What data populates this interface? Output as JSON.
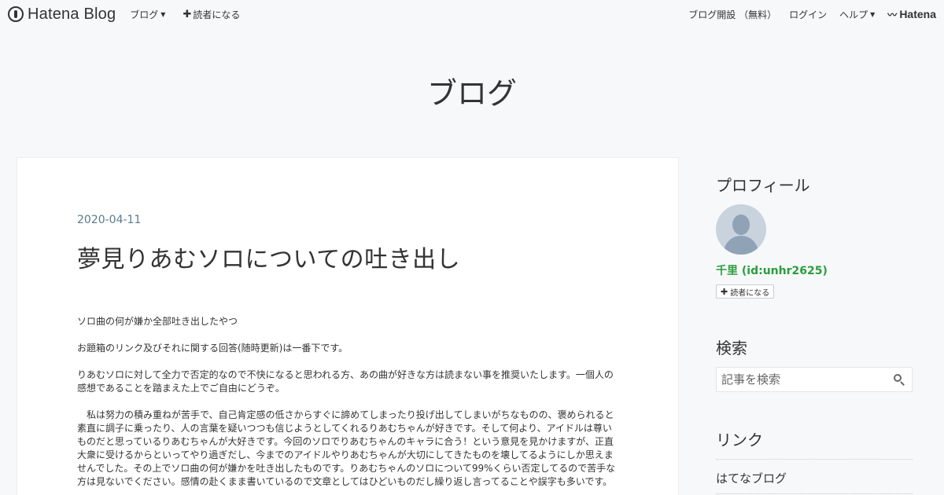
{
  "topbar": {
    "logo_text": "Hatena Blog",
    "blog_menu": "ブログ",
    "subscribe": "読者になる",
    "open_blog": "ブログ開設 （無料）",
    "login": "ログイン",
    "help": "ヘルプ",
    "brand": "Hatena"
  },
  "blog": {
    "title": "ブログ"
  },
  "entry": {
    "date": "2020-04-11",
    "title": "夢見りあむソロについての吐き出し",
    "paragraphs": [
      "ソロ曲の何が嫌か全部吐き出したやつ",
      "お題箱のリンク及びそれに関する回答(随時更新)は一番下です。",
      "りあむソロに対して全力で否定的なので不快になると思われる方、あの曲が好きな方は読まない事を推奨いたします。一個人の感想であることを踏まえた上でご自由にどうぞ。",
      "　私は努力の積み重ねが苦手で、自己肯定感の低さからすぐに諦めてしまったり投げ出してしまいがちなものの、褒められると素直に調子に乗ったり、人の言葉を疑いつつも信じようとしてくれるりあむちゃんが好きです。そして何より、アイドルは尊いものだと思っているりあむちゃんが大好きです。今回のソロでりあむちゃんのキャラに合う！という意見を見かけますが、正直大衆に受けるからといってやり過ぎだし、今までのアイドルやりあむちゃんが大切にしてきたものを壊してるようにしか思えませんでした。その上でソロ曲の何が嫌かを吐き出したものです。りあむちゃんのソロについて99%くらい否定してるので苦手な方は見ないでください。感情の赴くまま書いているので文章としてはひどいものだし繰り返し言ってることや誤字も多いです。"
    ]
  },
  "sidebar": {
    "profile_heading": "プロフィール",
    "profile_name": "千里 (id:unhr2625)",
    "follow_label": "読者になる",
    "search_heading": "検索",
    "search_placeholder": "記事を検索",
    "links_heading": "リンク",
    "links": [
      "はてなブログ"
    ]
  },
  "colors": {
    "background": "#f7f8fa",
    "card": "#ffffff",
    "date": "#5a7a8c",
    "profile_name": "#2a9d3e"
  },
  "icons": {
    "logo": "hatena-blog-logo-icon",
    "search": "search-icon",
    "avatar": "default-avatar-icon",
    "brand": "hatena-bird-icon"
  }
}
